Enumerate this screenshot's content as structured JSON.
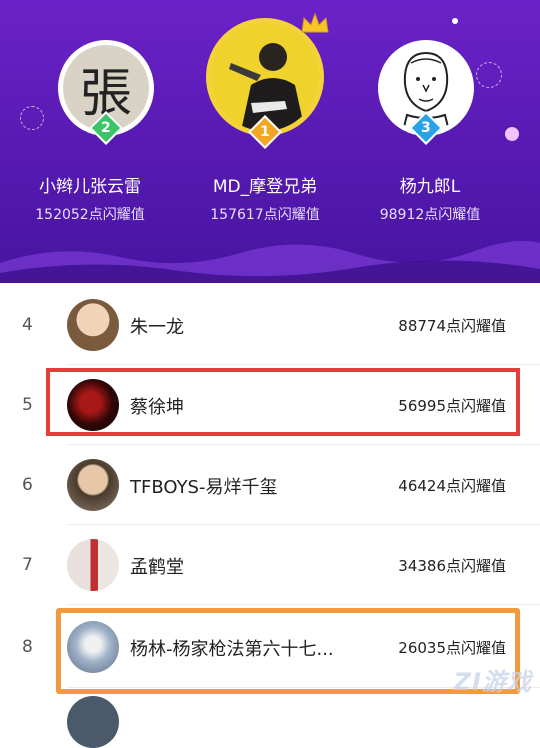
{
  "podium": [
    {
      "rank": "2",
      "name": "小辫儿张云雷",
      "score": "152052点闪耀值",
      "avatar_glyph": "張"
    },
    {
      "rank": "1",
      "name": "MD_摩登兄弟",
      "score": "157617点闪耀值"
    },
    {
      "rank": "3",
      "name": "杨九郎L",
      "score": "98912点闪耀值"
    }
  ],
  "rows": [
    {
      "rank": "4",
      "name": "朱一龙",
      "score": "88774点闪耀值"
    },
    {
      "rank": "5",
      "name": "蔡徐坤",
      "score": "56995点闪耀值"
    },
    {
      "rank": "6",
      "name": "TFBOYS-易烊千玺",
      "score": "46424点闪耀值"
    },
    {
      "rank": "7",
      "name": "孟鹤堂",
      "score": "34386点闪耀值"
    },
    {
      "rank": "8",
      "name": "杨林-杨家枪法第六十七...",
      "score": "26035点闪耀值"
    }
  ],
  "watermark": "ZI游戏",
  "colors": {
    "gold": "#f6d23a",
    "silver": "#3cc46a",
    "bronze": "#2aa3e6",
    "highlight_red": "#e63c3c",
    "highlight_orange": "#f29a3e",
    "header_purple": "#5a1bb5"
  }
}
